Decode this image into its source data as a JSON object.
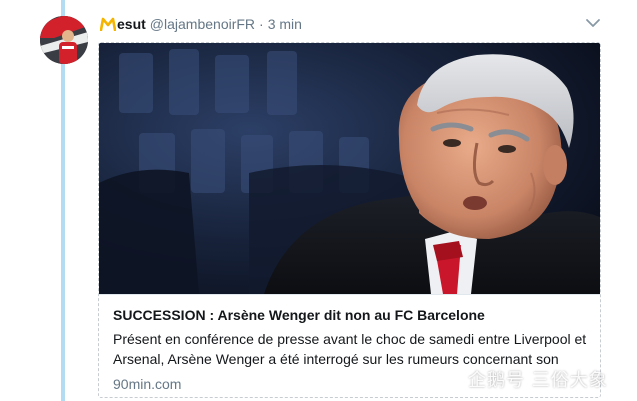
{
  "tweet": {
    "display_name_rest": "esut",
    "display_name_emoji": "M-shaped emoji",
    "handle": "@lajambenoirFR",
    "separator": "·",
    "time": "3 min"
  },
  "card": {
    "title": "SUCCESSION : Arsène Wenger dit non au FC Barcelone",
    "description": "Présent en conférence de presse avant le choc de samedi entre Liverpool et Arsenal, Arsène Wenger a été interrogé sur les rumeurs concernant son",
    "domain": "90min.com"
  },
  "watermark": {
    "text": "企鹅号 三俗大象"
  },
  "icons": {
    "caret": "chevron-down-icon",
    "avatar": "avatar",
    "watermark_logo": "penguin-logo"
  },
  "colors": {
    "thread_line": "#b3dcf3",
    "secondary_text": "#657786",
    "name_emoji": "#f5b400"
  }
}
